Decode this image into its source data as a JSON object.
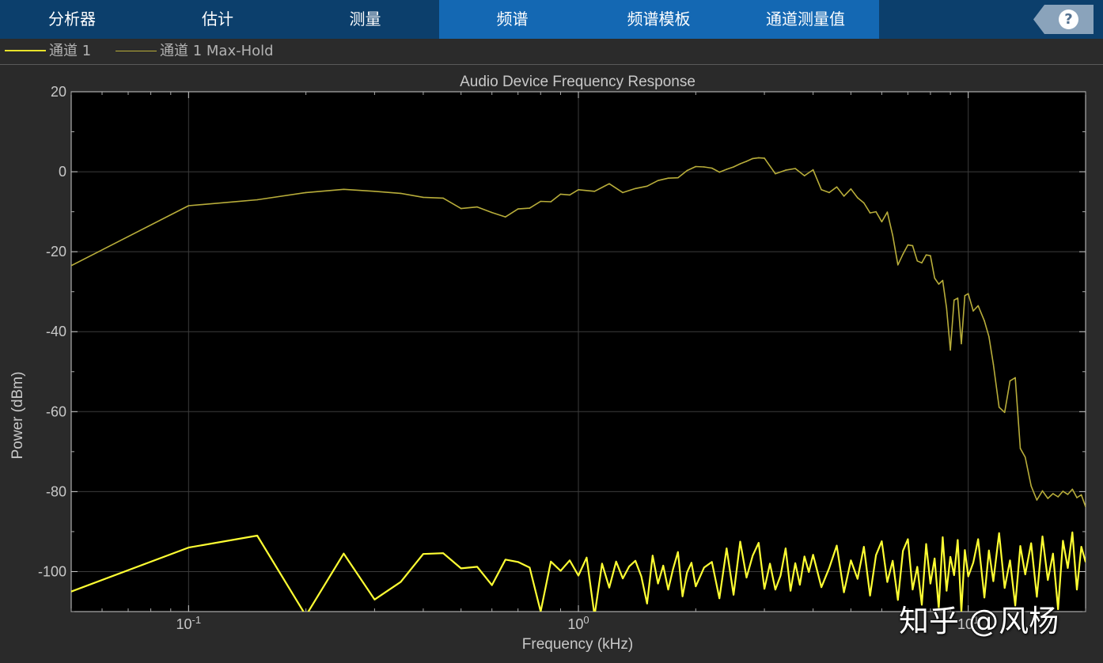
{
  "tabs": [
    {
      "label": "分析器",
      "active": false
    },
    {
      "label": "估计",
      "active": false
    },
    {
      "label": "测量",
      "active": false
    },
    {
      "label": "频谱",
      "active": true
    },
    {
      "label": "频谱模板",
      "active": false
    },
    {
      "label": "通道测量值",
      "active": false
    }
  ],
  "help": {
    "label": "?",
    "icon": "help-icon"
  },
  "legend": [
    {
      "label": "通道 1",
      "color": "#ffff33"
    },
    {
      "label": "通道 1 Max-Hold",
      "color": "#b8ad3a"
    }
  ],
  "watermark": "知乎 @风杨",
  "colors": {
    "trace": "#ffff33",
    "maxhold": "#b8ad3a",
    "plot_bg": "#000000",
    "grid": "#3a3a3a",
    "tab_bar": "#0c3f6c",
    "tab_active": "#1468b3"
  },
  "chart_data": {
    "type": "line",
    "title": "Audio Device Frequency Response",
    "xlabel": "Frequency (kHz)",
    "ylabel": "Power (dBm)",
    "xscale": "log",
    "xlim": [
      0.05,
      20
    ],
    "ylim": [
      -110,
      20
    ],
    "yticks": [
      20,
      0,
      -20,
      -40,
      -60,
      -80,
      -100
    ],
    "xticks": [
      {
        "value": 0.1,
        "label": "10-1"
      },
      {
        "value": 1,
        "label": "100"
      },
      {
        "value": 10,
        "label": "101"
      }
    ],
    "grid": true,
    "series": [
      {
        "name": "通道 1 Max-Hold",
        "color": "#b8ad3a",
        "x": [
          0.05,
          0.1,
          0.15,
          0.2,
          0.25,
          0.3,
          0.35,
          0.4,
          0.45,
          0.5,
          0.55,
          0.6,
          0.65,
          0.7,
          0.75,
          0.8,
          0.85,
          0.9,
          0.95,
          1.0,
          1.1,
          1.2,
          1.3,
          1.4,
          1.5,
          1.6,
          1.7,
          1.8,
          1.9,
          2.0,
          2.1,
          2.2,
          2.3,
          2.4,
          2.5,
          2.6,
          2.7,
          2.8,
          2.9,
          3.0,
          3.2,
          3.4,
          3.6,
          3.8,
          4.0,
          4.2,
          4.4,
          4.6,
          4.8,
          5.0,
          5.2,
          5.4,
          5.6,
          5.8,
          6.0,
          6.2,
          6.4,
          6.6,
          6.8,
          7.0,
          7.2,
          7.4,
          7.6,
          7.8,
          8.0,
          8.2,
          8.4,
          8.6,
          8.8,
          9.0,
          9.2,
          9.4,
          9.6,
          9.8,
          10.0,
          10.3,
          10.6,
          11.0,
          11.3,
          11.6,
          12.0,
          12.4,
          12.8,
          13.2,
          13.6,
          14.0,
          14.5,
          15.0,
          15.5,
          16.0,
          16.5,
          17.0,
          17.5,
          18.0,
          18.5,
          19.0,
          19.5,
          20.0
        ],
        "values": [
          -23.5,
          -8.5,
          -7,
          -5.2,
          -4.4,
          -4.9,
          -5.4,
          -6.4,
          -6.6,
          -9.2,
          -8.8,
          -10.2,
          -11.3,
          -9.3,
          -9.1,
          -7.4,
          -7.5,
          -5.6,
          -5.8,
          -4.5,
          -4.9,
          -3,
          -5.2,
          -4.2,
          -3.6,
          -2.2,
          -1.6,
          -1.5,
          0.3,
          1.3,
          1.2,
          0.9,
          -0.1,
          0.6,
          1.2,
          2,
          2.6,
          3.3,
          3.5,
          3.4,
          -0.5,
          0.4,
          0.8,
          -1,
          0.5,
          -4.5,
          -5.2,
          -3.8,
          -6.1,
          -4.3,
          -6.5,
          -7.8,
          -10.3,
          -10,
          -12.5,
          -10.1,
          -15.9,
          -23.3,
          -20.6,
          -18.3,
          -18.5,
          -22.3,
          -22.8,
          -20.8,
          -21,
          -26.6,
          -28.1,
          -27.2,
          -34.1,
          -44.6,
          -32.1,
          -31.6,
          -43,
          -31,
          -30.5,
          -34.8,
          -33.5,
          -37.3,
          -41.2,
          -48.1,
          -58.9,
          -60.2,
          -52.3,
          -51.5,
          -69.2,
          -71.4,
          -78.6,
          -82.1,
          -79.8,
          -81.7,
          -80.5,
          -81.3,
          -79.9,
          -80.7,
          -79.4,
          -81.5,
          -80.8,
          -83.8
        ]
      },
      {
        "name": "通道 1",
        "color": "#ffff33",
        "x": [
          0.05,
          0.1,
          0.15,
          0.2,
          0.25,
          0.3,
          0.35,
          0.4,
          0.45,
          0.5,
          0.55,
          0.6,
          0.65,
          0.7,
          0.75,
          0.8,
          0.85,
          0.9,
          0.95,
          1.0,
          1.05,
          1.1,
          1.15,
          1.2,
          1.25,
          1.3,
          1.35,
          1.4,
          1.45,
          1.5,
          1.55,
          1.6,
          1.65,
          1.7,
          1.75,
          1.8,
          1.85,
          1.9,
          1.95,
          2.0,
          2.1,
          2.2,
          2.3,
          2.4,
          2.5,
          2.6,
          2.7,
          2.8,
          2.9,
          3.0,
          3.1,
          3.2,
          3.3,
          3.4,
          3.5,
          3.6,
          3.7,
          3.8,
          3.9,
          4.0,
          4.2,
          4.4,
          4.6,
          4.8,
          5.0,
          5.2,
          5.4,
          5.6,
          5.8,
          6.0,
          6.2,
          6.4,
          6.6,
          6.8,
          7.0,
          7.2,
          7.4,
          7.6,
          7.8,
          8.0,
          8.2,
          8.4,
          8.6,
          8.8,
          9.0,
          9.2,
          9.4,
          9.6,
          9.8,
          10.0,
          10.3,
          10.6,
          11.0,
          11.3,
          11.6,
          12.0,
          12.4,
          12.8,
          13.2,
          13.6,
          14.0,
          14.5,
          15.0,
          15.5,
          16.0,
          16.5,
          17.0,
          17.5,
          18.0,
          18.5,
          19.0,
          19.5,
          20.0
        ],
        "values": [
          -105,
          -94,
          -91,
          -111,
          -95.5,
          -107,
          -102.6,
          -95.6,
          -95.4,
          -99.2,
          -98.8,
          -103.4,
          -97,
          -97.6,
          -99,
          -110,
          -97.5,
          -99.8,
          -97.2,
          -101,
          -96.5,
          -111,
          -98,
          -104,
          -97.5,
          -101.7,
          -98.7,
          -97.3,
          -101.2,
          -108,
          -96,
          -103,
          -98.5,
          -104.5,
          -99.3,
          -95.1,
          -106.2,
          -100.2,
          -97.8,
          -103.7,
          -99,
          -97.6,
          -106.7,
          -94.2,
          -105.8,
          -92.5,
          -101.5,
          -96,
          -92.8,
          -104.3,
          -98,
          -104.5,
          -101,
          -94.2,
          -104.8,
          -97.9,
          -103.3,
          -96.2,
          -100.1,
          -95.8,
          -103.9,
          -99.1,
          -93.5,
          -105.2,
          -97.2,
          -101.8,
          -93.8,
          -106,
          -95.9,
          -92.4,
          -102.6,
          -97.3,
          -107.1,
          -94.8,
          -91.9,
          -104.5,
          -98.8,
          -108.3,
          -93.1,
          -103,
          -96.7,
          -109.2,
          -91.4,
          -104.8,
          -96.3,
          -100.9,
          -92.1,
          -110,
          -94.6,
          -101.2,
          -97.8,
          -91.9,
          -106.5,
          -94.7,
          -102.4,
          -90.4,
          -104.1,
          -97.2,
          -108.5,
          -93.6,
          -100.7,
          -92.9,
          -106.3,
          -91.2,
          -102.1,
          -95.5,
          -109.4,
          -92.3,
          -99.1,
          -90.2,
          -104.5,
          -93.8,
          -97.6
        ]
      }
    ]
  }
}
